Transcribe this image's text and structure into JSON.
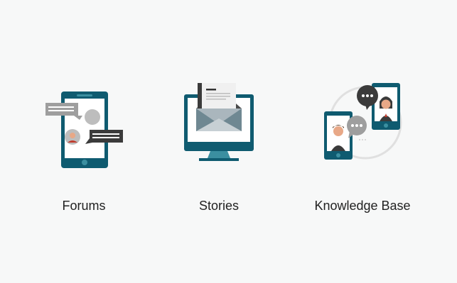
{
  "cards": [
    {
      "label": "Forums",
      "icon": "forums-phone-chat-icon"
    },
    {
      "label": "Stories",
      "icon": "stories-monitor-envelope-icon"
    },
    {
      "label": "Knowledge Base",
      "icon": "knowledge-base-video-call-icon"
    }
  ],
  "colors": {
    "teal": "#0f5b70",
    "teal_light": "#3b8fa0",
    "gray": "#9e9e9e",
    "dark": "#3b3b3b",
    "background": "#f7f8f8"
  }
}
